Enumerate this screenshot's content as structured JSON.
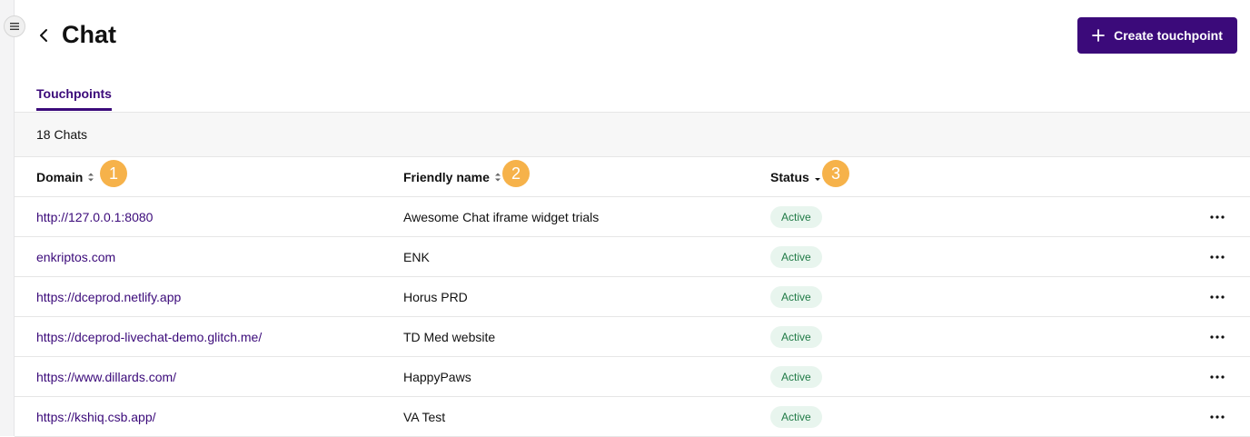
{
  "sidebar": {
    "toggle_icon": "menu-icon"
  },
  "header": {
    "back_icon": "chevron-left-icon",
    "title": "Chat",
    "create_button_icon": "plus-icon",
    "create_button_label": "Create touchpoint"
  },
  "tabs": [
    {
      "label": "Touchpoints",
      "active": true
    }
  ],
  "summary": {
    "count_text": "18 Chats"
  },
  "table": {
    "columns": [
      {
        "label": "Domain",
        "sort_icon": "sort-both-icon",
        "annotation": "1"
      },
      {
        "label": "Friendly name",
        "sort_icon": "sort-both-icon",
        "annotation": "2"
      },
      {
        "label": "Status",
        "sort_icon": "sort-descending-icon",
        "annotation": "3"
      }
    ],
    "rows": [
      {
        "domain": "http://127.0.0.1:8080",
        "friendly_name": "Awesome Chat iframe widget trials",
        "status": "Active"
      },
      {
        "domain": "enkriptos.com",
        "friendly_name": "ENK",
        "status": "Active"
      },
      {
        "domain": "https://dceprod.netlify.app",
        "friendly_name": "Horus PRD",
        "status": "Active"
      },
      {
        "domain": "https://dceprod-livechat-demo.glitch.me/",
        "friendly_name": "TD Med website",
        "status": "Active"
      },
      {
        "domain": "https://www.dillards.com/",
        "friendly_name": "HappyPaws",
        "status": "Active"
      },
      {
        "domain": "https://kshiq.csb.app/",
        "friendly_name": "VA Test",
        "status": "Active"
      }
    ],
    "row_action_icon": "more-horizontal-icon"
  },
  "colors": {
    "brand": "#3b0a7a",
    "annotation": "#f6b24a",
    "status_bg": "#e8f5ee",
    "status_text": "#1f7a45"
  }
}
